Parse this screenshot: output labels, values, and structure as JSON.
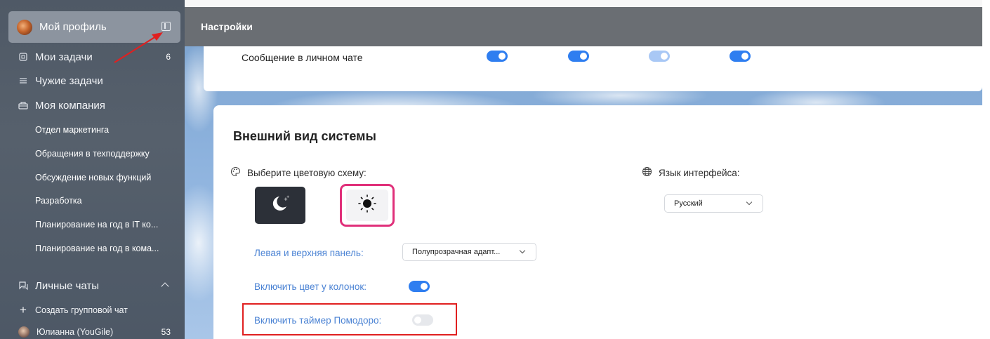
{
  "sidebar": {
    "profile_name": "Мой профиль",
    "items": [
      {
        "label": "Мои задачи",
        "count": "6"
      },
      {
        "label": "Чужие задачи"
      },
      {
        "label": "Моя компания"
      }
    ],
    "projects": [
      "Отдел маркетинга",
      "Обращения в техподдержку",
      "Обсуждение новых функций",
      "Разработка",
      "Планирование на год в IT ко...",
      "Планирование на год в кома..."
    ],
    "chats_label": "Личные чаты",
    "create_group_chat": "Создать групповой чат",
    "chat_user": {
      "name": "Юлианна (YouGile)",
      "count": "53"
    }
  },
  "header": {
    "title": "Настройки"
  },
  "notifications": {
    "row_label": "Сообщение в личном чате",
    "toggles": [
      "on",
      "on",
      "on-light",
      "on"
    ]
  },
  "appearance": {
    "section_title": "Внешний вид системы",
    "color_scheme_label": "Выберите цветовую схему:",
    "color_schemes": [
      "dark",
      "light"
    ],
    "selected_scheme": "light",
    "language_label": "Язык интерфейса:",
    "language_value": "Русский",
    "panel_label": "Левая и верхняя панель:",
    "panel_value": "Полупрозрачная адапт...",
    "column_color_label": "Включить цвет у колонок:",
    "column_color_enabled": true,
    "pomodoro_label": "Включить таймер Помодоро:",
    "pomodoro_enabled": false
  },
  "colors": {
    "accent": "#2f7ef0",
    "label_blue": "#4b83d4",
    "highlight_pink": "#e0307a",
    "annotation_red": "#e02020"
  }
}
